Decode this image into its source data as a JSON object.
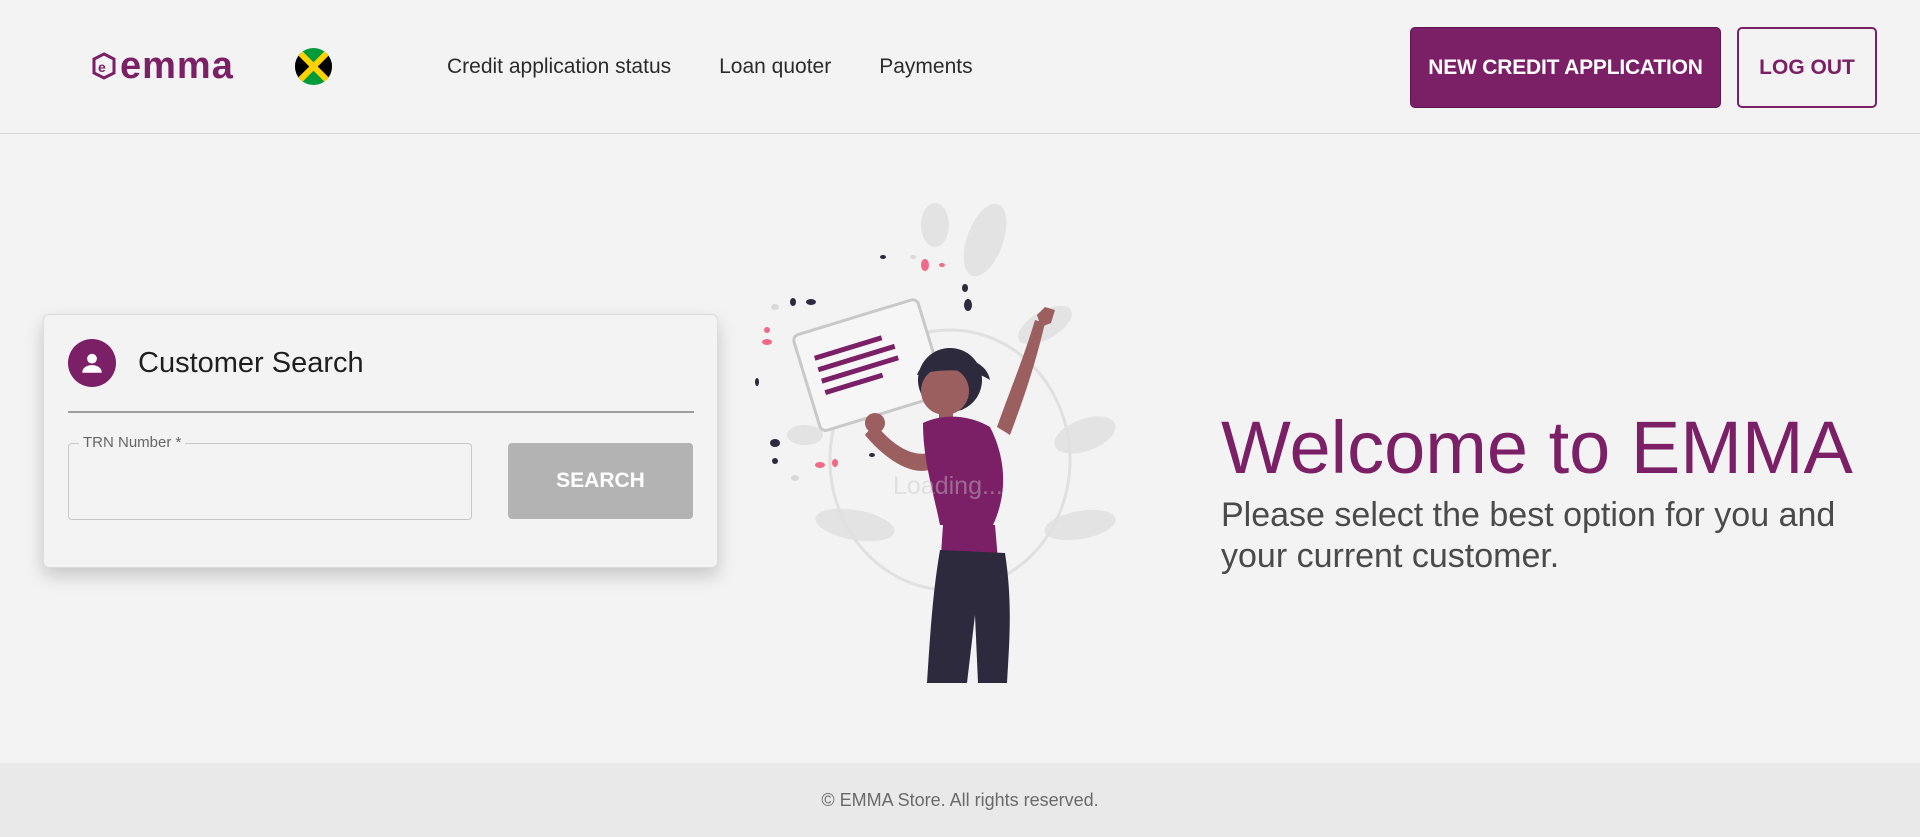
{
  "header": {
    "logo_text": "emma",
    "flag": "jamaica-flag",
    "nav": [
      {
        "label": "Credit application status"
      },
      {
        "label": "Loan quoter"
      },
      {
        "label": "Payments"
      }
    ],
    "new_application_label": "NEW CREDIT APPLICATION",
    "logout_label": "LOG OUT"
  },
  "search_card": {
    "title": "Customer Search",
    "icon": "person-icon",
    "trn_label": "TRN Number *",
    "trn_value": "",
    "search_label": "SEARCH"
  },
  "illustration": {
    "overlay_text": "Loading..."
  },
  "welcome": {
    "title": "Welcome to EMMA",
    "subtitle": "Please select the best option for you and your current customer."
  },
  "footer": {
    "text": "© EMMA Store. All rights reserved."
  },
  "colors": {
    "brand": "#7b1f66",
    "disabled_button": "#b3b3b3",
    "background": "#f3f3f3"
  }
}
